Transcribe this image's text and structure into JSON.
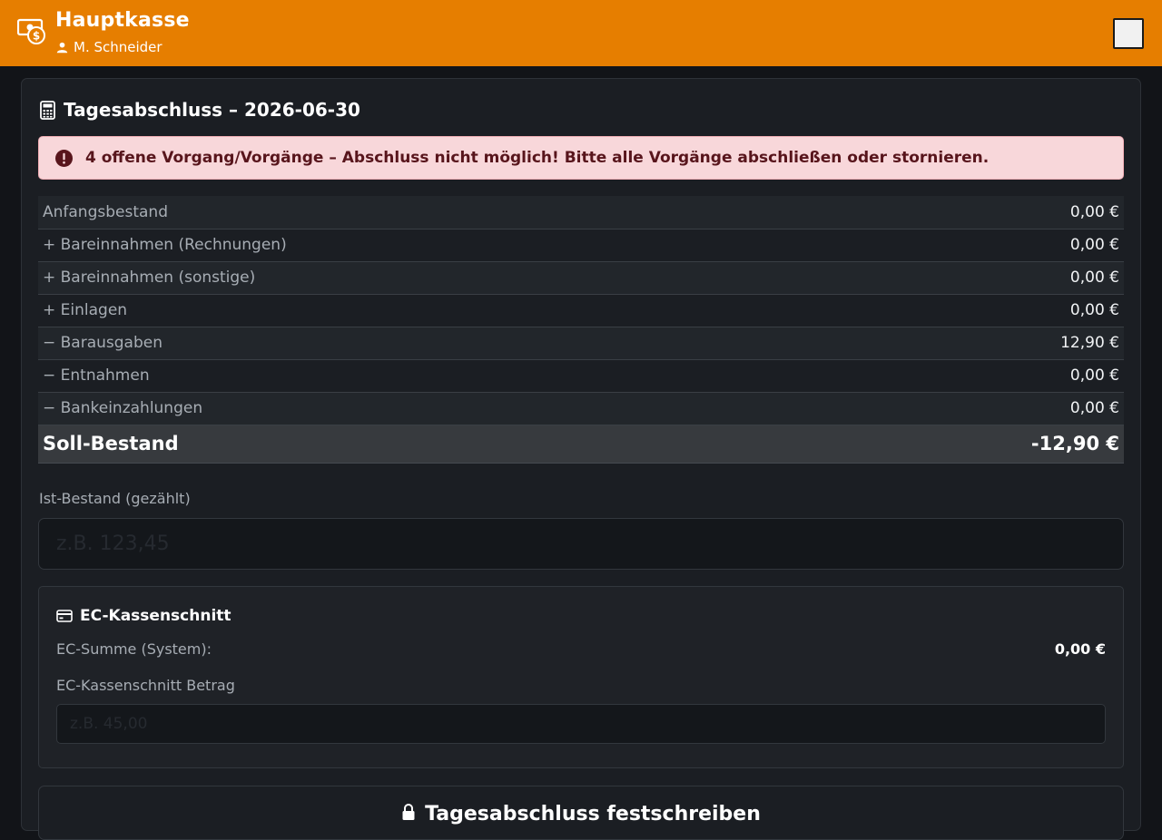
{
  "header": {
    "title": "Hauptkasse",
    "user": "M. Schneider",
    "icons": {
      "brand": "cash-register-money-icon",
      "user": "person-icon",
      "menu": "menu-icon"
    },
    "accent_color": "#e67e00"
  },
  "closing": {
    "title": "Tagesabschluss – 2026-06-30",
    "alert": {
      "text": "4 offene Vorgang/Vorgänge – Abschluss nicht möglich! Bitte alle Vorgänge abschließen oder stornieren.",
      "icon": "exclamation-circle-icon",
      "color": "#58151c",
      "background": "#f8d7da"
    },
    "rows": [
      {
        "label": "Anfangsbestand",
        "value": "0,00 €"
      },
      {
        "label": "+ Bareinnahmen (Rechnungen)",
        "value": "0,00 €"
      },
      {
        "label": "+ Bareinnahmen (sonstige)",
        "value": "0,00 €"
      },
      {
        "label": "+ Einlagen",
        "value": "0,00 €"
      },
      {
        "label": "− Barausgaben",
        "value": "12,90 €"
      },
      {
        "label": "− Entnahmen",
        "value": "0,00 €"
      },
      {
        "label": "− Bankeinzahlungen",
        "value": "0,00 €"
      }
    ],
    "total": {
      "label": "Soll-Bestand",
      "value": "-12,90 €"
    },
    "ist": {
      "label": "Ist-Bestand (gezählt)",
      "placeholder": "z.B. 123,45",
      "value": ""
    },
    "ec": {
      "title": "EC-Kassenschnitt",
      "sum_label": "EC-Summe (System):",
      "sum_value": "0,00 €",
      "field_label": "EC-Kassenschnitt Betrag",
      "placeholder": "z.B. 45,00",
      "value": ""
    },
    "commit_label": "Tagesabschluss festschreiben"
  }
}
